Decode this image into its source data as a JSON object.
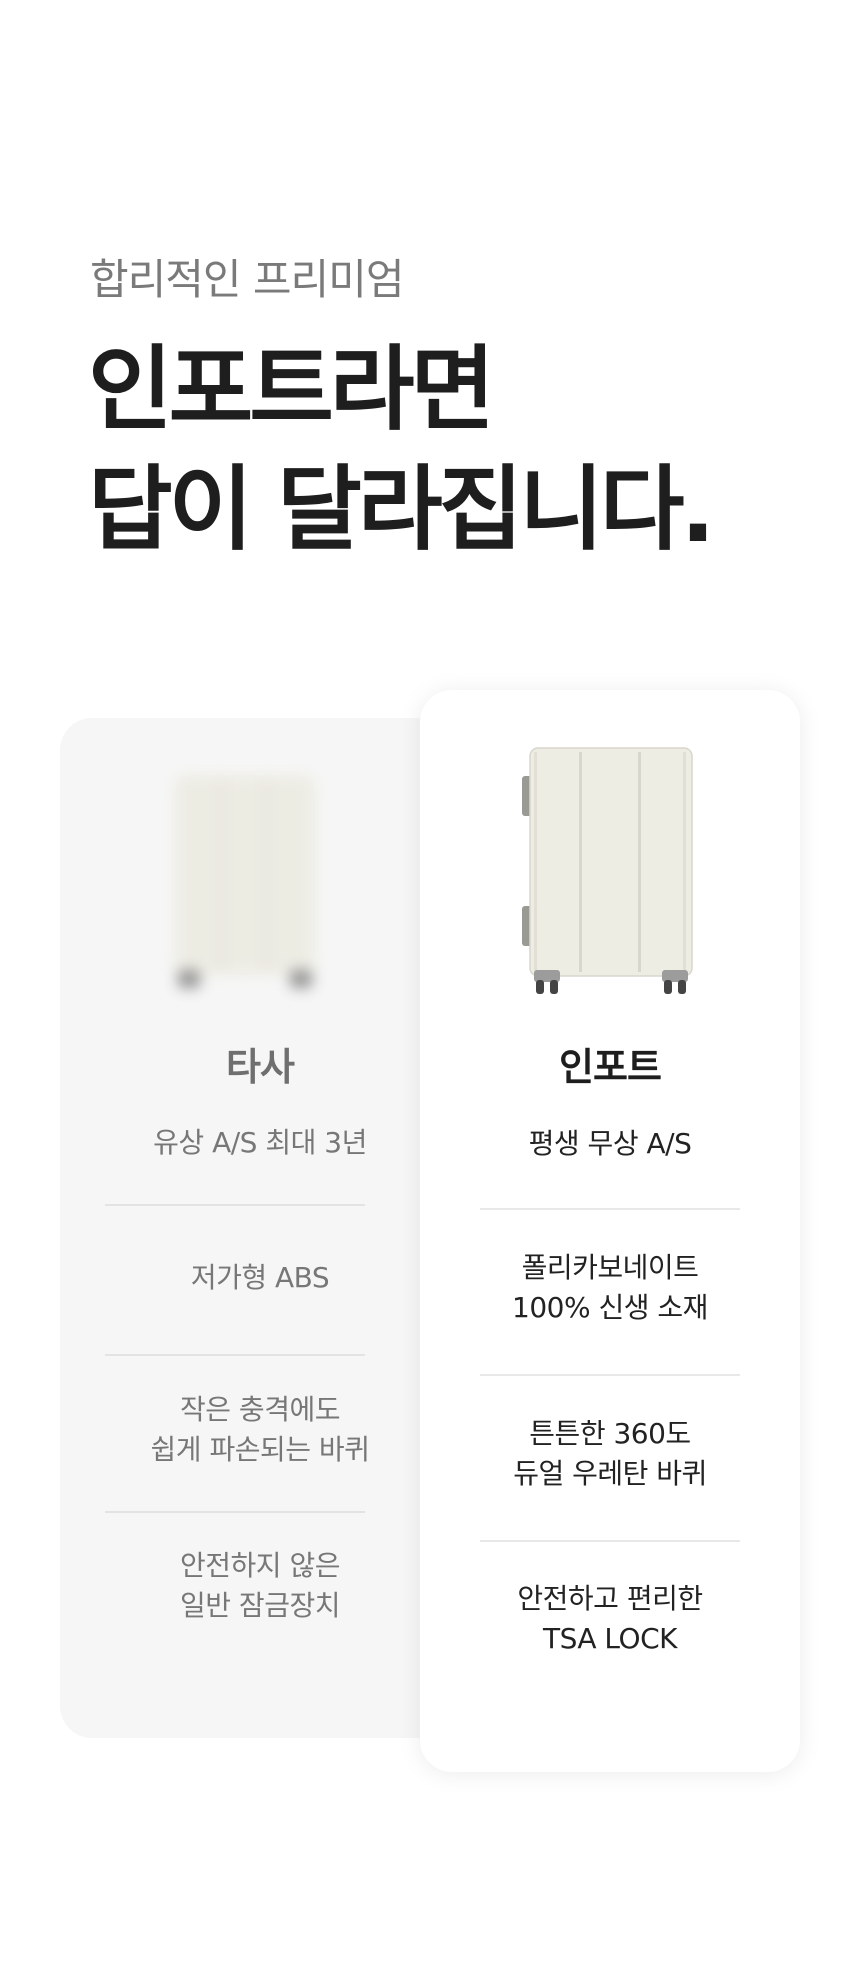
{
  "header": {
    "eyebrow": "합리적인 프리미엄",
    "headline_line1": "인포트라면",
    "headline_line2": "답이 달라집니다."
  },
  "compare": {
    "competitor": {
      "name": "타사",
      "features": [
        {
          "line1": "유상 A/S 최대 3년",
          "line2": ""
        },
        {
          "line1": "저가형 ABS",
          "line2": ""
        },
        {
          "line1": "작은 충격에도",
          "line2": "쉽게 파손되는 바퀴"
        },
        {
          "line1": "안전하지 않은",
          "line2": "일반 잠금장치"
        }
      ]
    },
    "inpot": {
      "name": "인포트",
      "features": [
        {
          "line1": "평생 무상 A/S",
          "line2": ""
        },
        {
          "line1": "폴리카보네이트",
          "line2": "100% 신생 소재"
        },
        {
          "line1": "튼튼한 360도",
          "line2": "듀얼 우레탄 바퀴"
        },
        {
          "line1": "안전하고 편리한",
          "line2": "TSA LOCK"
        }
      ]
    }
  },
  "colors": {
    "suitcase_body": "#eeede4",
    "wheel": "#555555",
    "card_left_bg": "#f6f6f6"
  }
}
